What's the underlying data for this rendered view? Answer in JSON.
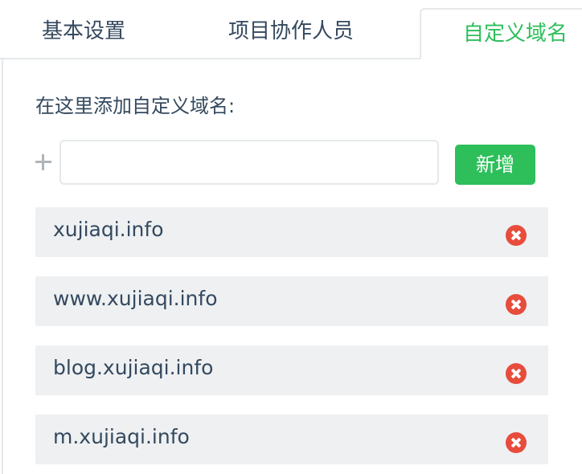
{
  "tabs": [
    {
      "label": "基本设置"
    },
    {
      "label": "项目协作人员"
    },
    {
      "label": "自定义域名",
      "active": true
    }
  ],
  "heading": "在这里添加自定义域名:",
  "new_domain": {
    "value": "",
    "placeholder": ""
  },
  "add_button_label": "新增",
  "domains": [
    {
      "name": "xujiaqi.info"
    },
    {
      "name": "www.xujiaqi.info"
    },
    {
      "name": "blog.xujiaqi.info"
    },
    {
      "name": "m.xujiaqi.info"
    }
  ],
  "colors": {
    "accent": "#2ebf5b",
    "text": "#34495e",
    "row_bg": "#eef0f2",
    "delete": "#e74c3c",
    "border": "#e5e8eb"
  },
  "icons": {
    "add": "plus-icon",
    "remove": "close-circle-icon"
  }
}
